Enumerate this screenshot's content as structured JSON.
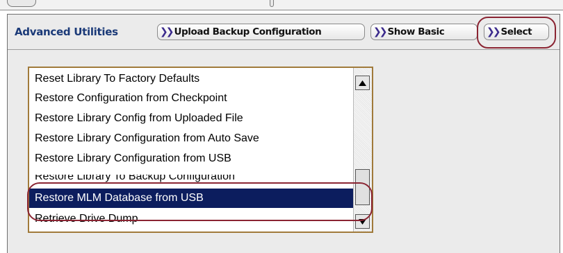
{
  "toolbar": {
    "title": "Advanced Utilities",
    "buttons": [
      {
        "label": "Upload Backup Configuration"
      },
      {
        "label": "Show Basic"
      },
      {
        "label": "Select"
      }
    ]
  },
  "listbox": {
    "items": [
      {
        "label": "Reset Library To Factory Defaults",
        "selected": false
      },
      {
        "label": "Restore Configuration from Checkpoint",
        "selected": false
      },
      {
        "label": "Restore Library Config from Uploaded File",
        "selected": false
      },
      {
        "label": "Restore Library Configuration from Auto Save",
        "selected": false
      },
      {
        "label": "Restore Library Configuration from USB",
        "selected": false
      },
      {
        "label": "Restore Library To Backup Configuration",
        "selected": false
      },
      {
        "label": "Restore MLM Database from USB",
        "selected": true
      },
      {
        "label": "Retrieve Drive Dump",
        "selected": false
      }
    ],
    "selected_index": 6
  },
  "colors": {
    "title": "#1b3a78",
    "selection": "#0c1d5e",
    "highlight_ring": "#8a2432",
    "listbox_border": "#a07a3a"
  },
  "icons": {
    "button_prefix": "double-chevron-right-icon",
    "scroll_up": "triangle-up-icon",
    "scroll_down": "triangle-down-icon"
  }
}
